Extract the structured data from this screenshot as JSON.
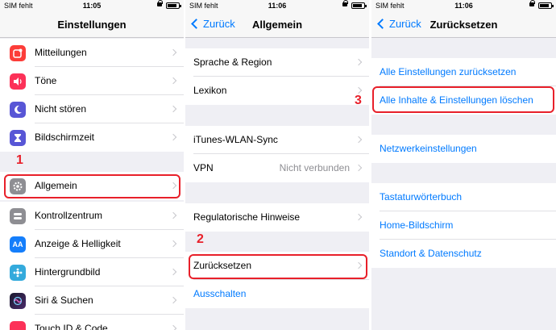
{
  "status": {
    "carrier": "SIM fehlt",
    "time1": "11:05",
    "time2": "11:06",
    "time3": "11:06"
  },
  "screen1": {
    "title": "Einstellungen",
    "items": [
      {
        "label": "Mitteilungen",
        "icon": "notifications-icon"
      },
      {
        "label": "Töne",
        "icon": "sounds-icon"
      },
      {
        "label": "Nicht stören",
        "icon": "moon-icon"
      },
      {
        "label": "Bildschirmzeit",
        "icon": "hourglass-icon"
      },
      {
        "label": "Allgemein",
        "icon": "gear-icon"
      },
      {
        "label": "Kontrollzentrum",
        "icon": "toggles-icon"
      },
      {
        "label": "Anzeige & Helligkeit",
        "icon": "display-icon",
        "glyph": "AA"
      },
      {
        "label": "Hintergrundbild",
        "icon": "wallpaper-icon"
      },
      {
        "label": "Siri & Suchen",
        "icon": "siri-icon"
      },
      {
        "label": "Touch ID & Code",
        "icon": "fingerprint-icon"
      }
    ],
    "step": "1"
  },
  "screen2": {
    "back": "Zurück",
    "title": "Allgemein",
    "items": [
      {
        "label": "Sprache & Region"
      },
      {
        "label": "Lexikon"
      },
      {
        "label": "iTunes-WLAN-Sync"
      },
      {
        "label": "VPN",
        "value": "Nicht verbunden"
      },
      {
        "label": "Regulatorische Hinweise"
      },
      {
        "label": "Zurücksetzen"
      },
      {
        "label": "Ausschalten"
      }
    ],
    "step": "2"
  },
  "screen3": {
    "back": "Zurück",
    "title": "Zurücksetzen",
    "items": [
      {
        "label": "Alle Einstellungen zurücksetzen"
      },
      {
        "label": "Alle Inhalte & Einstellungen löschen"
      },
      {
        "label": "Netzwerkeinstellungen"
      },
      {
        "label": "Tastaturwörterbuch"
      },
      {
        "label": "Home-Bildschirm"
      },
      {
        "label": "Standort & Datenschutz"
      }
    ],
    "step": "3"
  },
  "colors": {
    "accent": "#007aff",
    "highlight": "#e8202a",
    "background": "#efeff4"
  }
}
